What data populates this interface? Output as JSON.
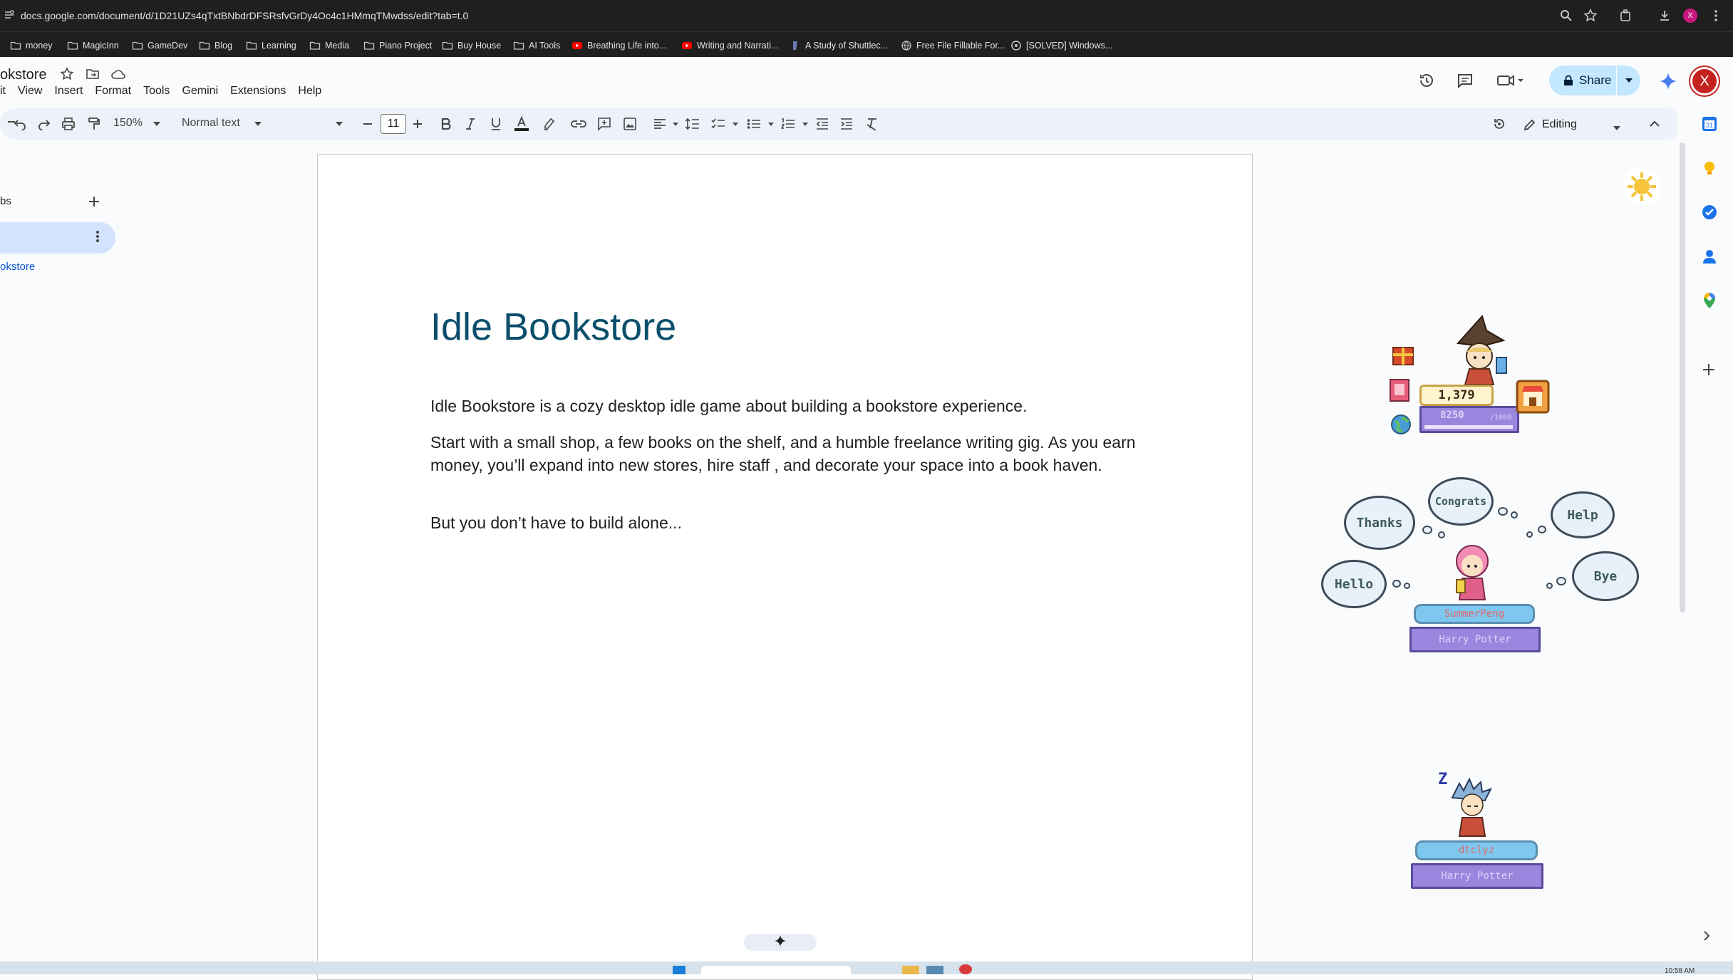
{
  "browser": {
    "url": "docs.google.com/document/d/1D21UZs4qTxtBNbdrDFSRsfvGrDy4Oc4c1HMmqTMwdss/edit?tab=t.0",
    "bookmarks": [
      {
        "label": "money",
        "icon": "folder-icon"
      },
      {
        "label": "MagicInn",
        "icon": "folder-icon"
      },
      {
        "label": "GameDev",
        "icon": "folder-icon"
      },
      {
        "label": "Blog",
        "icon": "folder-icon"
      },
      {
        "label": "Learning",
        "icon": "folder-icon"
      },
      {
        "label": "Media",
        "icon": "folder-icon"
      },
      {
        "label": "Piano Project",
        "icon": "folder-icon"
      },
      {
        "label": "Buy House",
        "icon": "folder-icon"
      },
      {
        "label": "AI Tools",
        "icon": "folder-icon"
      },
      {
        "label": "Breathing Life into...",
        "icon": "youtube-icon"
      },
      {
        "label": "Writing and Narrati...",
        "icon": "youtube-icon"
      },
      {
        "label": "A Study of Shuttlec...",
        "icon": "site-icon"
      },
      {
        "label": "Free File Fillable For...",
        "icon": "globe-icon"
      },
      {
        "label": "[SOLVED] Windows...",
        "icon": "site-icon"
      }
    ],
    "profile_letter": "X"
  },
  "doc": {
    "title": "okstore",
    "menu": [
      "it",
      "View",
      "Insert",
      "Format",
      "Tools",
      "Gemini",
      "Extensions",
      "Help"
    ],
    "share_label": "Share",
    "avatar_letter": "X",
    "editing_label": "Editing"
  },
  "toolbar": {
    "zoom": "150%",
    "style": "Normal text",
    "font": "",
    "font_size": "11"
  },
  "tabs_panel": {
    "label": "bs",
    "outline_item": "okstore"
  },
  "content": {
    "heading": "Idle Bookstore",
    "paragraphs": [
      "Idle Bookstore is a cozy desktop idle game about building a bookstore experience.",
      "Start with a small shop, a few books on the shelf, and a humble freelance writing gig. As you earn money, you’ll expand into new stores, hire staff , and decorate your space into a book haven.",
      "But you don’t have to build alone..."
    ]
  },
  "game_overlay": {
    "coins": "1,379",
    "progress_text": "8250",
    "progress_max": "/1000",
    "bubbles": [
      "Thanks",
      "Congrats",
      "Help",
      "Hello",
      "Bye"
    ],
    "players": [
      {
        "name": "SummerPeng",
        "book": "Harry Potter"
      },
      {
        "name": "dtclyz",
        "book": "Harry Potter"
      }
    ],
    "sleep_glyph": "Z"
  },
  "taskbar": {
    "clock": "10:58 AM"
  },
  "colors": {
    "heading": "#0b4f6c",
    "link": "#0b57d0",
    "share_bg": "#c2e7ff",
    "toolbar_bg": "#edf2fa",
    "avatar": "#c5221f"
  }
}
